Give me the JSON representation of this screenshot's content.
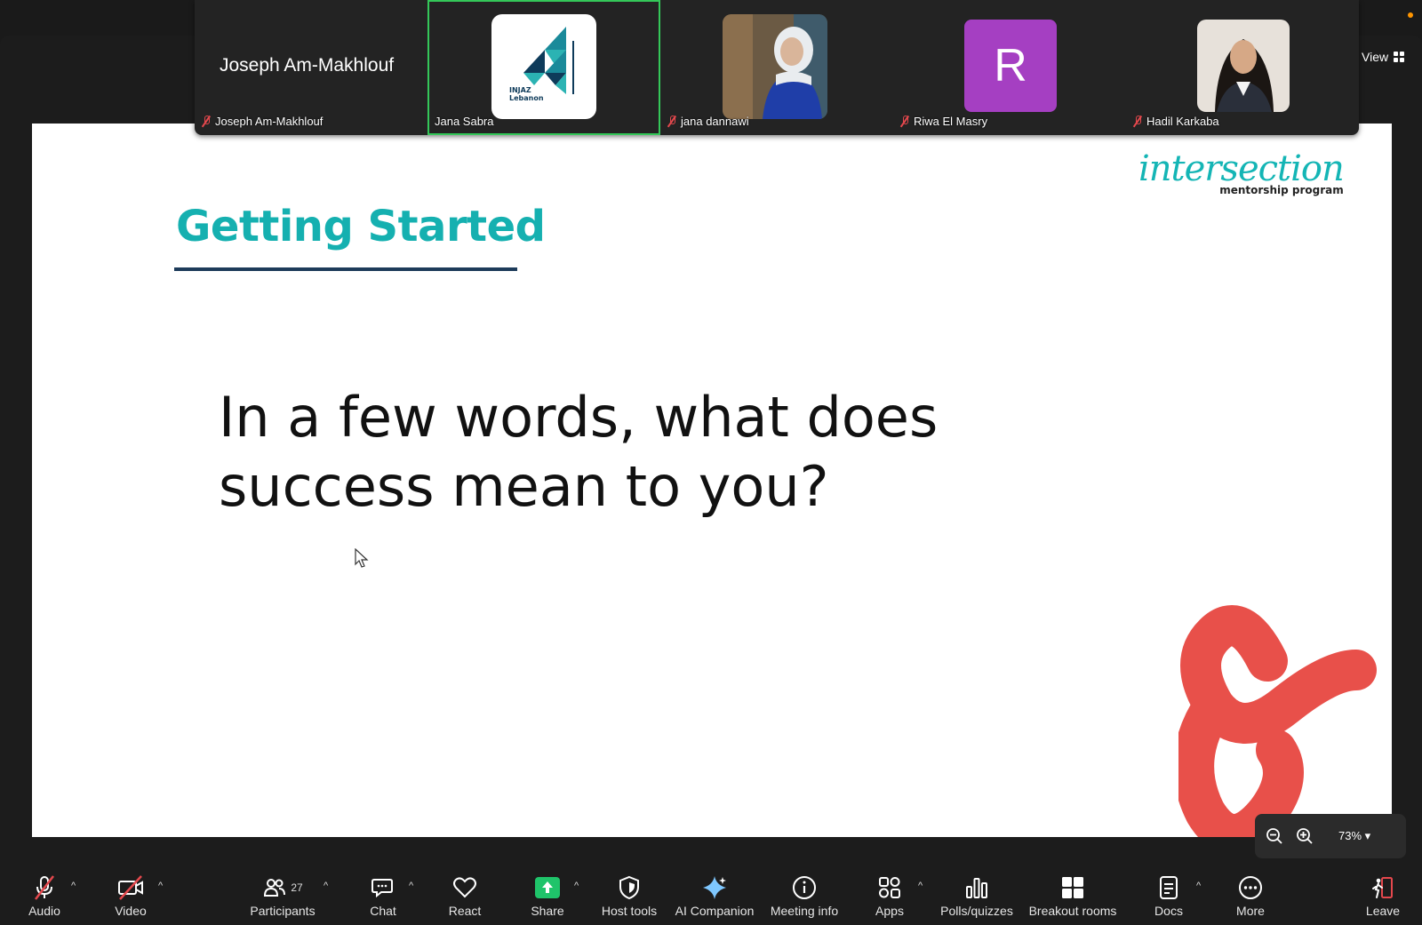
{
  "gallery": {
    "tiles": [
      {
        "display": "Joseph Am-Makhlouf",
        "label": "Joseph Am-Makhlouf",
        "muted": true
      },
      {
        "label": "Jana Sabra",
        "logo_lines": [
          "INJAZ",
          "Lebanon"
        ],
        "active": true
      },
      {
        "label": "jana dannawi",
        "muted": true
      },
      {
        "label": "Riwa El Masry",
        "avatar_letter": "R",
        "muted": true
      },
      {
        "label": "Hadil Karkaba",
        "muted": true
      }
    ],
    "view_label": "View"
  },
  "slide": {
    "title": "Getting Started",
    "question_line1": "In a few words, what does",
    "question_line2": "success mean to you?",
    "brand_name": "intersection",
    "brand_sub": "mentorship program"
  },
  "zoom": {
    "level": "73%"
  },
  "toolbar": {
    "audio": "Audio",
    "video": "Video",
    "participants": "Participants",
    "participants_count": "27",
    "chat": "Chat",
    "react": "React",
    "share": "Share",
    "host_tools": "Host tools",
    "ai_companion": "AI Companion",
    "meeting_info": "Meeting info",
    "apps": "Apps",
    "polls": "Polls/quizzes",
    "breakout": "Breakout rooms",
    "docs": "Docs",
    "more": "More",
    "leave": "Leave"
  },
  "colors": {
    "accent_teal": "#15b0b0",
    "active_speaker": "#34c759",
    "share_green": "#1fc46a",
    "avatar_purple": "#a53fc2",
    "deco_red": "#e8504a"
  }
}
